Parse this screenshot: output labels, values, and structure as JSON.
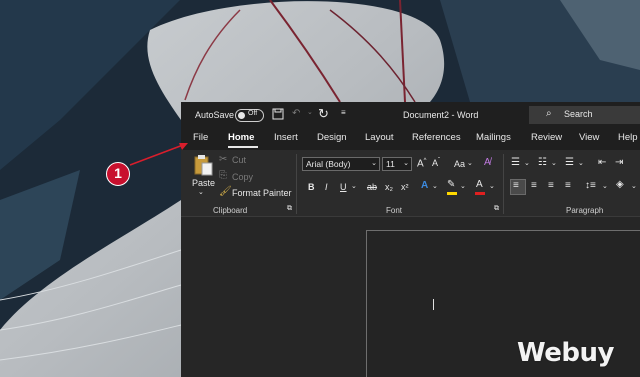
{
  "title_bar": {
    "autosave_label": "AutoSave",
    "autosave_state": "Off",
    "document_title": "Document2 - Word",
    "search_placeholder": "Search"
  },
  "ribbon_tabs": [
    "File",
    "Home",
    "Insert",
    "Design",
    "Layout",
    "References",
    "Mailings",
    "Review",
    "View",
    "Help"
  ],
  "active_tab": "Home",
  "clipboard": {
    "paste": "Paste",
    "cut": "Cut",
    "copy": "Copy",
    "format_painter": "Format Painter",
    "group_label": "Clipboard"
  },
  "font": {
    "font_name": "Arial (Body)",
    "font_size": "11",
    "group_label": "Font",
    "change_case": "Aa",
    "buttons": [
      "B",
      "I",
      "U",
      "ab",
      "x₂",
      "x²"
    ]
  },
  "paragraph": {
    "group_label": "Paragraph"
  },
  "annotation": {
    "step_number": "1"
  },
  "watermark": "Webuy",
  "colors": {
    "ribbon_bg": "#2b2b2b",
    "title_bg": "#1f1f1f",
    "badge": "#c8102e",
    "arrow": "#d81e2c",
    "highlight_yellow": "#ffd800",
    "font_color_red": "#e02020",
    "text_effects_blue": "#3d8be0"
  }
}
